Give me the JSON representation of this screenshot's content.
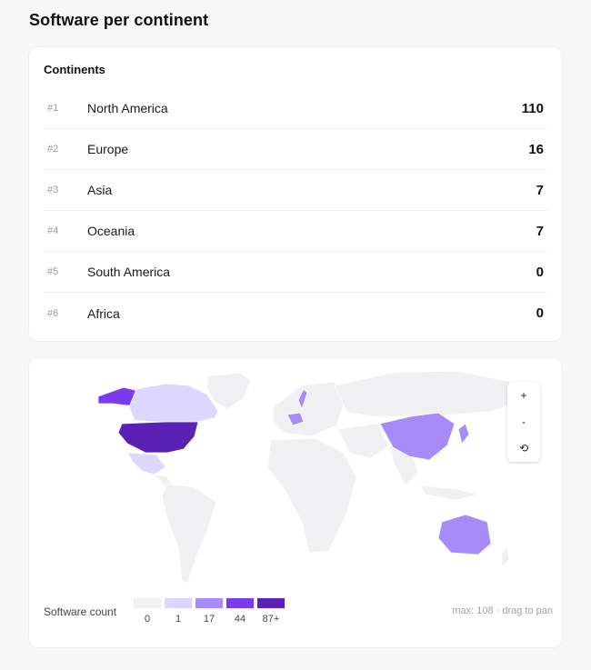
{
  "page": {
    "title": "Software per continent"
  },
  "continents": {
    "heading": "Continents",
    "rows": [
      {
        "rank": "#1",
        "name": "North America",
        "count": "110"
      },
      {
        "rank": "#2",
        "name": "Europe",
        "count": "16"
      },
      {
        "rank": "#3",
        "name": "Asia",
        "count": "7"
      },
      {
        "rank": "#4",
        "name": "Oceania",
        "count": "7"
      },
      {
        "rank": "#5",
        "name": "South America",
        "count": "0"
      },
      {
        "rank": "#6",
        "name": "Africa",
        "count": "0"
      }
    ]
  },
  "map": {
    "zoom_in": "+",
    "zoom_out": "-",
    "reset": "⟲",
    "legend": {
      "label": "Software count",
      "steps": [
        {
          "value": "0",
          "color": "#f1f1f4"
        },
        {
          "value": "1",
          "color": "#ddd6fe"
        },
        {
          "value": "17",
          "color": "#a78bfa"
        },
        {
          "value": "44",
          "color": "#7c3aed"
        },
        {
          "value": "87+",
          "color": "#5b21b6"
        }
      ],
      "note": "max: 108 · drag to pan"
    },
    "colors": {
      "base": "#f0f0f2",
      "light": "#ddd6fe",
      "medium": "#a78bfa",
      "strong": "#7c3aed",
      "dark": "#5b21b6"
    }
  }
}
